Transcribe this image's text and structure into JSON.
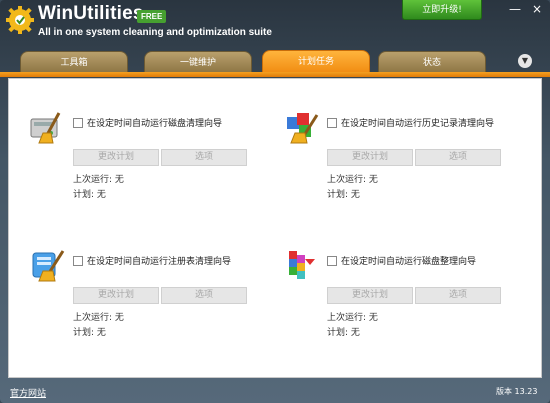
{
  "header": {
    "title": "WinUtilities",
    "badge": "FREE",
    "tagline": "All in one system cleaning and optimization suite",
    "upgrade_label": "立即升级!",
    "minimize_glyph": "—",
    "close_glyph": "×"
  },
  "tabs": [
    {
      "label": "工具箱",
      "active": false
    },
    {
      "label": "一键维护",
      "active": false
    },
    {
      "label": "计划任务",
      "active": true
    },
    {
      "label": "状态",
      "active": false
    }
  ],
  "tab_menu_glyph": "▼",
  "tasks": [
    {
      "icon": "disk-cleanup-icon",
      "label": "在设定时间自动运行磁盘清理向导",
      "checked": false,
      "schedule_label": "更改计划",
      "options_label": "选项",
      "last_run": "上次运行: 无",
      "plan": "计划: 无"
    },
    {
      "icon": "history-cleanup-icon",
      "label": "在设定时间自动运行历史记录清理向导",
      "checked": false,
      "schedule_label": "更改计划",
      "options_label": "选项",
      "last_run": "上次运行: 无",
      "plan": "计划: 无"
    },
    {
      "icon": "registry-cleanup-icon",
      "label": "在设定时间自动运行注册表清理向导",
      "checked": false,
      "schedule_label": "更改计划",
      "options_label": "选项",
      "last_run": "上次运行: 无",
      "plan": "计划: 无"
    },
    {
      "icon": "disk-defrag-icon",
      "label": "在设定时间自动运行磁盘整理向导",
      "checked": false,
      "schedule_label": "更改计划",
      "options_label": "选项",
      "last_run": "上次运行: 无",
      "plan": "计划: 无"
    }
  ],
  "footer": {
    "website_link": "官方网站",
    "version": "版本 13.23"
  },
  "colors": {
    "accent_orange": "#f08a10",
    "upgrade_green": "#2f8a1d",
    "tab_inactive": "#8a7242"
  }
}
